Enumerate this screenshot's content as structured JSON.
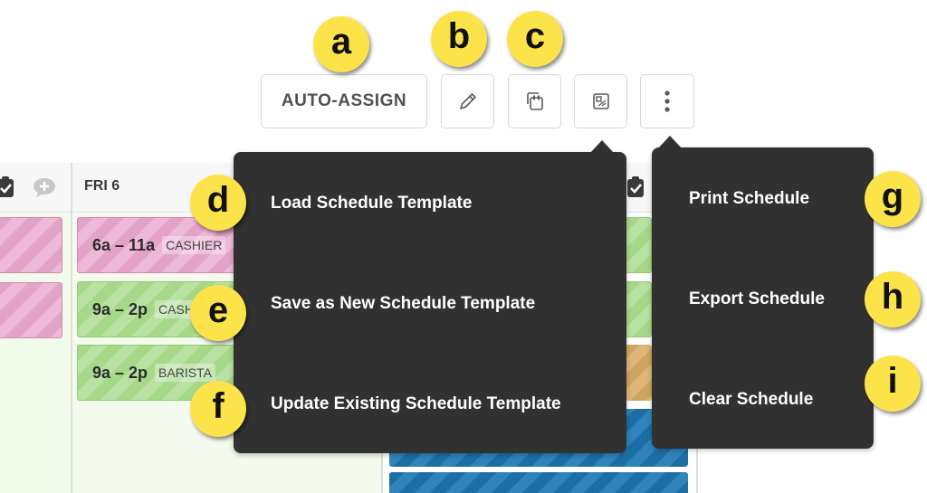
{
  "toolbar": {
    "auto_assign_label": "AUTO-ASSIGN",
    "edit_icon": "pencil-icon",
    "copy_icon": "copy-schedule-icon",
    "template_icon": "schedule-template-icon",
    "more_icon": "kebab-menu-icon"
  },
  "schedule": {
    "day_label": "FRI 6",
    "shifts": [
      {
        "time": "6a – 11a",
        "role": "CASHIER",
        "color": "#e3a3c7"
      },
      {
        "time": "9a – 2p",
        "role": "CASHIER",
        "color": "#a6d889"
      },
      {
        "time": "9a – 2p",
        "role": "BARISTA",
        "color": "#a6d889"
      }
    ]
  },
  "template_menu": {
    "items": [
      "Load Schedule Template",
      "Save as New Schedule Template",
      "Update Existing Schedule Template"
    ]
  },
  "more_menu": {
    "items": [
      "Print Schedule",
      "Export Schedule",
      "Clear Schedule"
    ]
  },
  "callouts": [
    "a",
    "b",
    "c",
    "d",
    "e",
    "f",
    "g",
    "h",
    "i"
  ],
  "colors": {
    "menu_bg": "#313131",
    "callout": "#fde34a",
    "pink_shift": "#e3a3c7",
    "green_shift": "#a6d889",
    "orange_shift": "#d1a45f",
    "blue_shift": "#1d6ea5"
  }
}
